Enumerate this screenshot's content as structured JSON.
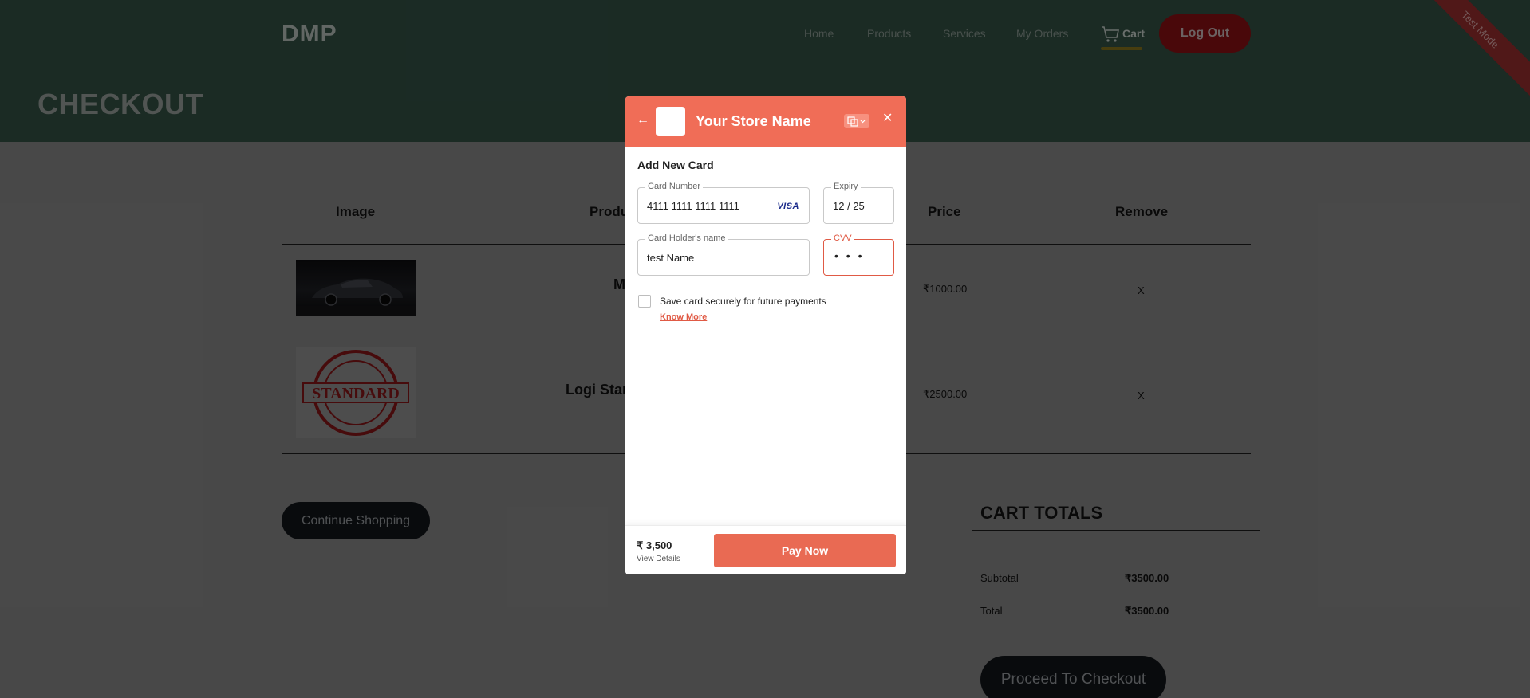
{
  "header": {
    "logo": "DMP",
    "nav": [
      {
        "label": "Home"
      },
      {
        "label": "Products"
      },
      {
        "label": "Services"
      },
      {
        "label": "My Orders"
      }
    ],
    "cart_label": "Cart",
    "logout_label": "Log Out"
  },
  "page_title": "CHECKOUT",
  "ribbon": "Test Mode",
  "table": {
    "headers": [
      "Image",
      "Produ",
      "Price",
      "Remove"
    ],
    "rows": [
      {
        "name": "M",
        "price": "₹1000.00",
        "remove": "X",
        "image": "car-photo"
      },
      {
        "name": "Logi Star",
        "price": "₹2500.00",
        "remove": "X",
        "image": "standard-stamp-photo"
      }
    ]
  },
  "continue_label": "Continue Shopping",
  "cart_totals": {
    "title": "CART TOTALS",
    "subtotal_label": "Subtotal",
    "subtotal_value": "₹3500.00",
    "total_label": "Total",
    "total_value": "₹3500.00",
    "proceed_label": "Proceed To Checkout"
  },
  "payment_modal": {
    "store_name": "Your Store Name",
    "section_title": "Add New Card",
    "card_number_label": "Card Number",
    "card_number_value": "4111 1111 1111 1111",
    "card_brand": "VISA",
    "expiry_label": "Expiry",
    "expiry_value": "12 / 25",
    "holder_label": "Card Holder's name",
    "holder_value": "test Name",
    "cvv_label": "CVV",
    "cvv_value": "• • •",
    "save_card_label": "Save card securely for future payments",
    "save_card_checked": false,
    "know_more_label": "Know More",
    "amount": "₹ 3,500",
    "view_details_label": "View Details",
    "pay_label": "Pay Now"
  },
  "colors": {
    "header_bg": "#2f4a3f",
    "modal_accent": "#f06d57",
    "logout_bg": "#7e0f12",
    "ribbon_bg": "#8b2a2a"
  }
}
